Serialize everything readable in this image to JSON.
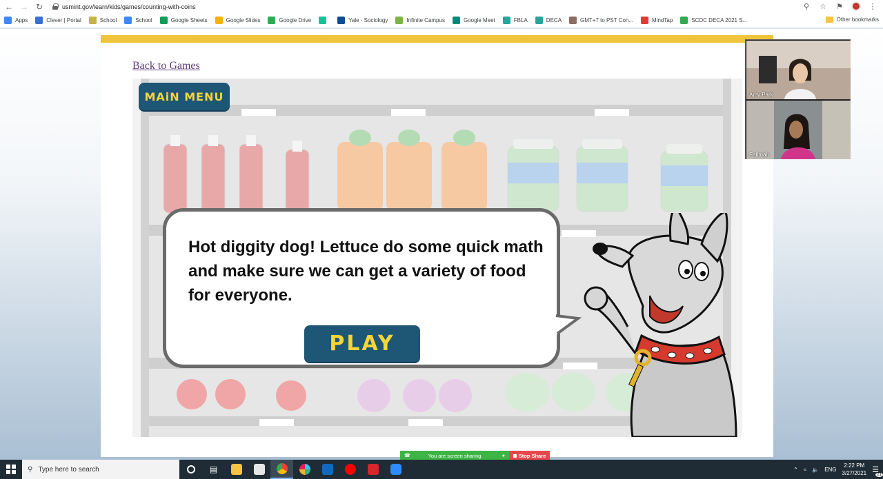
{
  "browser": {
    "url": "usmint.gov/learn/kids/games/counting-with-coins",
    "bookmarks": [
      {
        "label": "Apps",
        "color": "#4285f4"
      },
      {
        "label": "Clever | Portal",
        "color": "#3a6fd8"
      },
      {
        "label": "School",
        "color": "#c7b24a"
      },
      {
        "label": "School",
        "color": "#4285f4"
      },
      {
        "label": "Google Sheets",
        "color": "#0f9d58"
      },
      {
        "label": "Google Slides",
        "color": "#f4b400"
      },
      {
        "label": "Google Drive",
        "color": "#34a853"
      },
      {
        "label": "",
        "color": "#15c39a"
      },
      {
        "label": "Yale - Sociology",
        "color": "#0f4d92"
      },
      {
        "label": "Infinite Campus",
        "color": "#7cb342"
      },
      {
        "label": "Google Meet",
        "color": "#00897b"
      },
      {
        "label": "FBLA",
        "color": "#26a69a"
      },
      {
        "label": "DECA",
        "color": "#26a69a"
      },
      {
        "label": "GMT+7 to PST Con...",
        "color": "#8d6e63"
      },
      {
        "label": "MindTap",
        "color": "#e53935"
      },
      {
        "label": "SCDC DECA 2021 S...",
        "color": "#34a853"
      }
    ],
    "other_bookmarks": "Other bookmarks"
  },
  "page": {
    "back_link": "Back to Games"
  },
  "game": {
    "main_menu_label": "MAiN MENU",
    "dialog_text": "Hot diggity dog! Lettuce do some quick math and make sure we can get a variety of food for everyone.",
    "play_label": "PLAY"
  },
  "zoom": {
    "participants": [
      "Amy Park",
      "Fatimah"
    ],
    "sharing_status": "You are screen sharing",
    "stop_share": "Stop Share"
  },
  "taskbar": {
    "search_placeholder": "Type here to search",
    "language": "ENG",
    "time": "2:22 PM",
    "date": "3/27/2021",
    "notification_count": "21"
  }
}
